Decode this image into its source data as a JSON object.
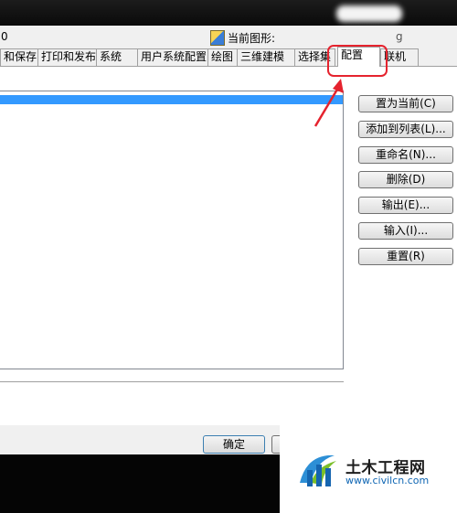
{
  "header": {
    "profile_value": "0",
    "current_drawing_label": "当前图形:",
    "current_drawing_value": "g"
  },
  "tabs": [
    {
      "label": "和保存",
      "active": false
    },
    {
      "label": "打印和发布",
      "active": false
    },
    {
      "label": "系统",
      "active": false
    },
    {
      "label": "用户系统配置",
      "active": false
    },
    {
      "label": "绘图",
      "active": false
    },
    {
      "label": "三维建模",
      "active": false
    },
    {
      "label": "选择集",
      "active": false
    },
    {
      "label": "配置",
      "active": true
    },
    {
      "label": "联机",
      "active": false
    }
  ],
  "buttons": {
    "set_current": "置为当前(C)",
    "add_to_list": "添加到列表(L)...",
    "rename": "重命名(N)...",
    "delete": "删除(D)",
    "export": "输出(E)...",
    "import": "输入(I)...",
    "reset": "重置(R)"
  },
  "footer": {
    "ok": "确定"
  },
  "watermark": {
    "name": "土木工程网",
    "url": "www.civilcn.com"
  },
  "colors": {
    "selection": "#3399ff",
    "highlight": "#e5232e"
  }
}
